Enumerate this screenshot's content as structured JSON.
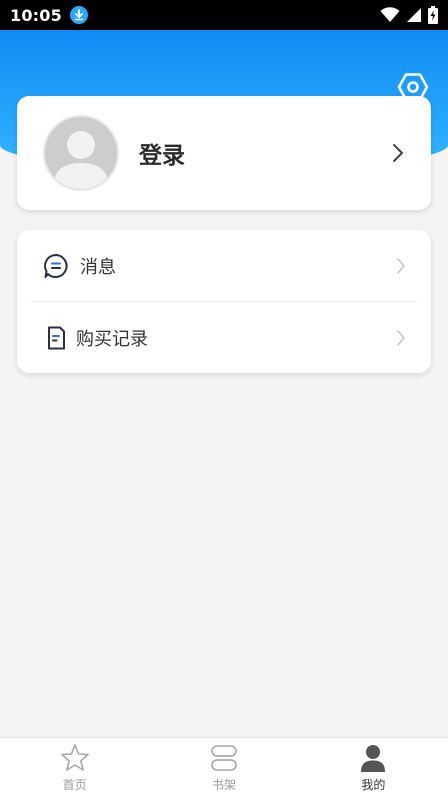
{
  "status_bar": {
    "time": "10:05",
    "icons": [
      "download-icon",
      "wifi-icon",
      "signal-icon",
      "battery-icon"
    ]
  },
  "header": {
    "settings_icon": "hexagon-settings-icon",
    "gradient_start": "#0e8cf5",
    "gradient_end": "#34b4ff"
  },
  "login_card": {
    "label": "登录"
  },
  "menu": {
    "items": [
      {
        "label": "消息",
        "icon": "message-icon"
      },
      {
        "label": "购买记录",
        "icon": "record-icon"
      }
    ]
  },
  "bottom_nav": {
    "items": [
      {
        "label": "首页",
        "icon": "star-icon",
        "active": false
      },
      {
        "label": "书架",
        "icon": "bookshelf-icon",
        "active": false
      },
      {
        "label": "我的",
        "icon": "person-icon",
        "active": true
      }
    ]
  }
}
